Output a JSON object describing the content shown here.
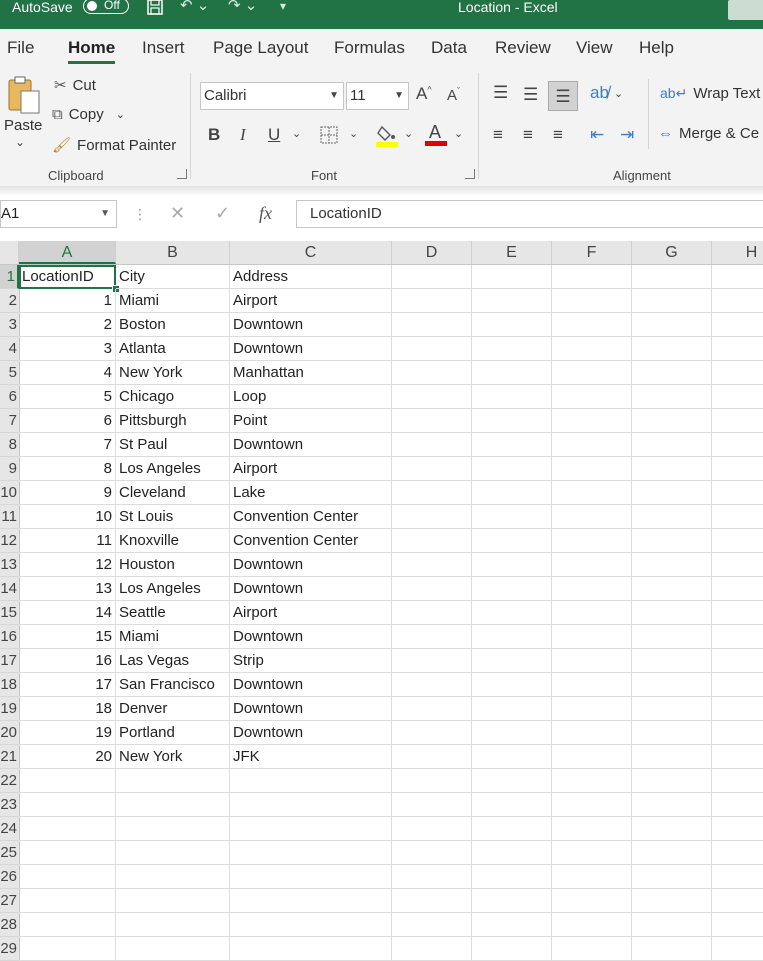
{
  "titlebar": {
    "autosave_label": "AutoSave",
    "autosave_state": "Off",
    "title": "Location  -  Excel"
  },
  "tabs": [
    "File",
    "Home",
    "Insert",
    "Page Layout",
    "Formulas",
    "Data",
    "Review",
    "View",
    "Help"
  ],
  "active_tab": "Home",
  "clipboard": {
    "paste": "Paste",
    "cut": "Cut",
    "copy": "Copy",
    "format_painter": "Format Painter",
    "group": "Clipboard"
  },
  "font": {
    "family": "Calibri",
    "size": "11",
    "bold": "B",
    "italic": "I",
    "underline": "U",
    "group": "Font",
    "fill_color": "#ffff00",
    "font_color": "#e00000"
  },
  "alignment": {
    "wrap_text": "Wrap Text",
    "merge": "Merge & Ce",
    "group": "Alignment"
  },
  "formula_bar": {
    "name_box": "A1",
    "fx": "fx",
    "content": "LocationID"
  },
  "columns": [
    "A",
    "B",
    "C",
    "D",
    "E",
    "F",
    "G",
    "H"
  ],
  "selected_column": "A",
  "rows": [
    "1",
    "2",
    "3",
    "4",
    "5",
    "6",
    "7",
    "8",
    "9",
    "10",
    "11",
    "12",
    "13",
    "14",
    "15",
    "16",
    "17",
    "18",
    "19",
    "20",
    "21",
    "22",
    "23",
    "24",
    "25",
    "26",
    "27",
    "28",
    "29"
  ],
  "header_row": [
    "LocationID",
    "City",
    "Address"
  ],
  "data_rows": [
    [
      "1",
      "Miami",
      "Airport"
    ],
    [
      "2",
      "Boston",
      "Downtown"
    ],
    [
      "3",
      "Atlanta",
      "Downtown"
    ],
    [
      "4",
      "New York",
      "Manhattan"
    ],
    [
      "5",
      "Chicago",
      "Loop"
    ],
    [
      "6",
      "Pittsburgh",
      "Point"
    ],
    [
      "7",
      "St Paul",
      "Downtown"
    ],
    [
      "8",
      "Los Angeles",
      "Airport"
    ],
    [
      "9",
      "Cleveland",
      "Lake"
    ],
    [
      "10",
      "St Louis",
      "Convention Center"
    ],
    [
      "11",
      "Knoxville",
      "Convention Center"
    ],
    [
      "12",
      "Houston",
      "Downtown"
    ],
    [
      "13",
      "Los Angeles",
      "Downtown"
    ],
    [
      "14",
      "Seattle",
      "Airport"
    ],
    [
      "15",
      "Miami",
      "Downtown"
    ],
    [
      "16",
      "Las Vegas",
      "Strip"
    ],
    [
      "17",
      "San Francisco",
      "Downtown"
    ],
    [
      "18",
      "Denver",
      "Downtown"
    ],
    [
      "19",
      "Portland",
      "Downtown"
    ],
    [
      "20",
      "New York",
      "JFK"
    ]
  ],
  "colors": {
    "accent": "#217346"
  }
}
